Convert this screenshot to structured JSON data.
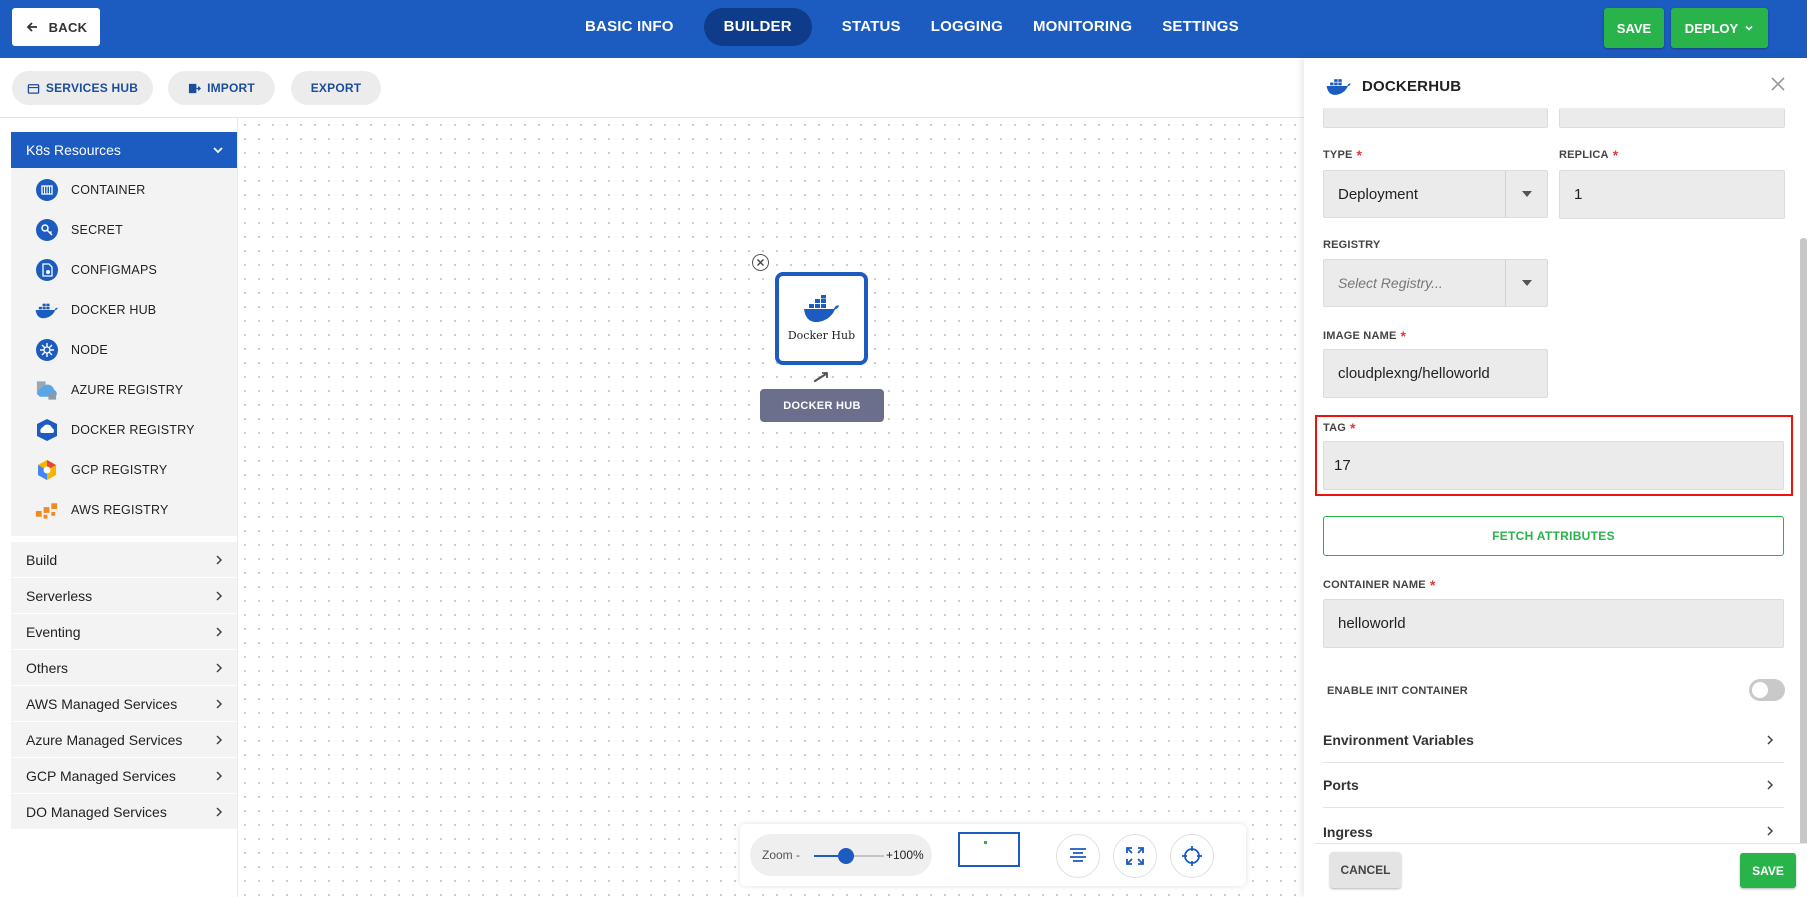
{
  "header": {
    "back_label": "BACK",
    "tabs": [
      "BASIC INFO",
      "BUILDER",
      "STATUS",
      "LOGGING",
      "MONITORING",
      "SETTINGS"
    ],
    "active_tab": "BUILDER",
    "save_label": "SAVE",
    "deploy_label": "DEPLOY"
  },
  "toolbar": {
    "services_hub": "SERVICES HUB",
    "import": "IMPORT",
    "export": "EXPORT"
  },
  "sidebar": {
    "k8s_title": "K8s Resources",
    "k8s_items": [
      {
        "label": "CONTAINER",
        "icon": "container-icon"
      },
      {
        "label": "SECRET",
        "icon": "secret-icon"
      },
      {
        "label": "CONFIGMAPS",
        "icon": "configmap-icon"
      },
      {
        "label": "DOCKER HUB",
        "icon": "docker-icon"
      },
      {
        "label": "NODE",
        "icon": "node-icon"
      },
      {
        "label": "AZURE REGISTRY",
        "icon": "azure-cloud-icon"
      },
      {
        "label": "DOCKER REGISTRY",
        "icon": "docker-registry-icon"
      },
      {
        "label": "GCP REGISTRY",
        "icon": "gcp-icon"
      },
      {
        "label": "AWS REGISTRY",
        "icon": "aws-icon"
      }
    ],
    "categories": [
      "Build",
      "Serverless",
      "Eventing",
      "Others",
      "AWS Managed Services",
      "Azure Managed Services",
      "GCP Managed Services",
      "DO Managed Services"
    ]
  },
  "canvas": {
    "node_title": "Docker Hub",
    "node_label": "DOCKER HUB"
  },
  "zoom": {
    "label": "Zoom -",
    "value": "+100%",
    "slider_fraction": 0.45
  },
  "panel": {
    "title": "DOCKERHUB",
    "type_label": "TYPE",
    "type_value": "Deployment",
    "replica_label": "REPLICA",
    "replica_value": "1",
    "registry_label": "REGISTRY",
    "registry_placeholder": "Select Registry...",
    "image_label": "IMAGE NAME",
    "image_value": "cloudplexng/helloworld",
    "tag_label": "TAG",
    "tag_value": "17",
    "fetch_label": "FETCH ATTRIBUTES",
    "container_label": "CONTAINER NAME",
    "container_value": "helloworld",
    "init_label": "ENABLE INIT CONTAINER",
    "init_enabled": false,
    "accordions": [
      "Environment Variables",
      "Ports",
      "Ingress"
    ],
    "cancel_label": "CANCEL",
    "save_label": "SAVE"
  },
  "colors": {
    "primary": "#1c5bbf",
    "primary_dark": "#0e3b8a",
    "success": "#28b34b",
    "highlight": "#e11111",
    "node_label_bg": "#6b6f8c"
  }
}
